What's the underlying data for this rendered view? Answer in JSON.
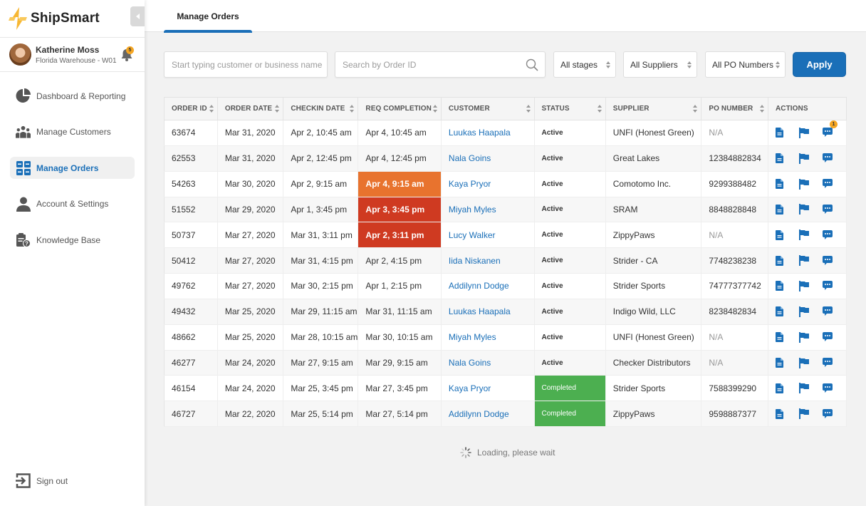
{
  "app": {
    "name": "ShipSmart"
  },
  "user": {
    "name": "Katherine Moss",
    "location": "Florida Warehouse - W01",
    "notifications": "5"
  },
  "nav": {
    "items": [
      {
        "label": "Dashboard & Reporting",
        "icon": "pie-chart-icon",
        "active": false
      },
      {
        "label": "Manage Customers",
        "icon": "users-icon",
        "active": false
      },
      {
        "label": "Manage Orders",
        "icon": "orders-grid-icon",
        "active": true
      },
      {
        "label": "Account & Settings",
        "icon": "user-icon",
        "active": false
      },
      {
        "label": "Knowledge Base",
        "icon": "clipboard-help-icon",
        "active": false
      }
    ],
    "signout": "Sign out"
  },
  "tabs": [
    {
      "label": "Manage Orders",
      "active": true
    }
  ],
  "filters": {
    "customer_placeholder": "Start typing customer or business name",
    "order_placeholder": "Search by Order ID",
    "stage": "All stages",
    "supplier": "All Suppliers",
    "po": "All PO Numbers",
    "apply": "Apply"
  },
  "table": {
    "columns": [
      "ORDER ID",
      "ORDER DATE",
      "CHECKIN DATE",
      "REQ COMPLETION",
      "CUSTOMER",
      "STATUS",
      "SUPPLIER",
      "PO NUMBER",
      "ACTIONS"
    ],
    "rows": [
      {
        "id": "63674",
        "order_date": "Mar 31, 2020",
        "checkin": "Apr 2, 10:45 am",
        "req": "Apr 4, 10:45 am",
        "req_flag": "",
        "customer": "Luukas Haapala",
        "status": "Active",
        "supplier": "UNFI (Honest Green)",
        "po": "N/A",
        "messages": "1"
      },
      {
        "id": "62553",
        "order_date": "Mar 31, 2020",
        "checkin": "Apr 2, 12:45 pm",
        "req": "Apr 4, 12:45 pm",
        "req_flag": "",
        "customer": "Nala Goins",
        "status": "Active",
        "supplier": "Great Lakes",
        "po": "12384882834",
        "messages": ""
      },
      {
        "id": "54263",
        "order_date": "Mar 30, 2020",
        "checkin": "Apr 2, 9:15 am",
        "req": "Apr 4, 9:15 am",
        "req_flag": "warning",
        "customer": "Kaya Pryor",
        "status": "Active",
        "supplier": "Comotomo Inc.",
        "po": "9299388482",
        "messages": ""
      },
      {
        "id": "51552",
        "order_date": "Mar 29, 2020",
        "checkin": "Apr 1, 3:45 pm",
        "req": "Apr 3, 3:45 pm",
        "req_flag": "overdue",
        "customer": "Miyah Myles",
        "status": "Active",
        "supplier": "SRAM",
        "po": "8848828848",
        "messages": ""
      },
      {
        "id": "50737",
        "order_date": "Mar 27, 2020",
        "checkin": "Mar 31, 3:11 pm",
        "req": "Apr 2, 3:11 pm",
        "req_flag": "overdue",
        "customer": "Lucy Walker",
        "status": "Active",
        "supplier": "ZippyPaws",
        "po": "N/A",
        "messages": ""
      },
      {
        "id": "50412",
        "order_date": "Mar 27, 2020",
        "checkin": "Mar 31, 4:15 pm",
        "req": "Apr 2, 4:15 pm",
        "req_flag": "",
        "customer": "Iida Niskanen",
        "status": "Active",
        "supplier": "Strider - CA",
        "po": "7748238238",
        "messages": ""
      },
      {
        "id": "49762",
        "order_date": "Mar 27, 2020",
        "checkin": "Mar 30, 2:15 pm",
        "req": "Apr 1, 2:15 pm",
        "req_flag": "",
        "customer": "Addilynn Dodge",
        "status": "Active",
        "supplier": "Strider Sports",
        "po": "74777377742",
        "messages": ""
      },
      {
        "id": "49432",
        "order_date": "Mar 25, 2020",
        "checkin": "Mar 29, 11:15 am",
        "req": "Mar 31, 11:15 am",
        "req_flag": "",
        "customer": "Luukas Haapala",
        "status": "Active",
        "supplier": "Indigo Wild, LLC",
        "po": "8238482834",
        "messages": ""
      },
      {
        "id": "48662",
        "order_date": "Mar 25, 2020",
        "checkin": "Mar 28, 10:15 am",
        "req": "Mar 30, 10:15 am",
        "req_flag": "",
        "customer": "Miyah Myles",
        "status": "Active",
        "supplier": "UNFI (Honest Green)",
        "po": "N/A",
        "messages": ""
      },
      {
        "id": "46277",
        "order_date": "Mar 24, 2020",
        "checkin": "Mar 27, 9:15 am",
        "req": "Mar 29, 9:15 am",
        "req_flag": "",
        "customer": "Nala Goins",
        "status": "Active",
        "supplier": "Checker Distributors",
        "po": "N/A",
        "messages": ""
      },
      {
        "id": "46154",
        "order_date": "Mar 24, 2020",
        "checkin": "Mar 25, 3:45 pm",
        "req": "Mar 27, 3:45 pm",
        "req_flag": "",
        "customer": "Kaya Pryor",
        "status": "Completed",
        "supplier": "Strider Sports",
        "po": "7588399290",
        "messages": ""
      },
      {
        "id": "46727",
        "order_date": "Mar 22, 2020",
        "checkin": "Mar 25, 5:14 pm",
        "req": "Mar 27, 5:14 pm",
        "req_flag": "",
        "customer": "Addilynn Dodge",
        "status": "Completed",
        "supplier": "ZippyPaws",
        "po": "9598887377",
        "messages": ""
      }
    ]
  },
  "loading": "Loading, please wait",
  "colors": {
    "accent": "#1a6fb8",
    "warning": "#e8732e",
    "overdue": "#cf3a21",
    "completed": "#4caf50",
    "badge": "#f5a623"
  }
}
